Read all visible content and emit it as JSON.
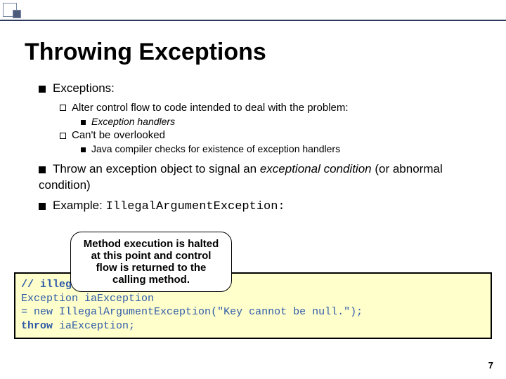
{
  "title": "Throwing Exceptions",
  "b1": "Exceptions:",
  "b1a": "Alter control flow to code intended to deal with the problem:",
  "b1a1": "Exception handlers",
  "b1b": "Can't be overlooked",
  "b1b1": "Java compiler checks for existence of exception handlers",
  "b2a": "Throw an exception object to signal an ",
  "b2b": "exceptional condition",
  "b2c": " (or abnormal condition)",
  "b3a": "Example: ",
  "b3b": "IllegalArgumentException:",
  "callout": "Method execution is halted at this point and control flow is returned to the calling method.",
  "code": {
    "l1": "// illegal argument",
    "l2a": "Exception",
    "l2b": " iaException",
    "l3a": "  = new ",
    "l3b": "IllegalArgumentException",
    "l3c": "(\"Key cannot be null.\");",
    "l4a": "throw",
    "l4b": " iaException;"
  },
  "page": "7"
}
